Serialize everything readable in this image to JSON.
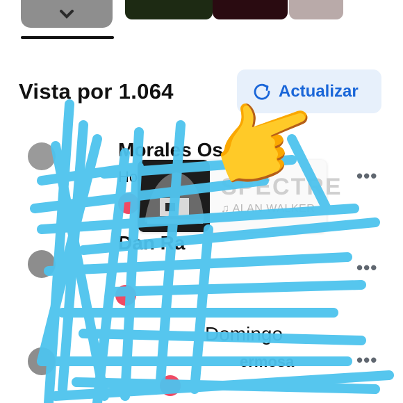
{
  "header": {
    "more_stories_icon": "chevron-down-icon",
    "story_colors": [
      "#1a2a12",
      "#2a0a10",
      "#b8a8a8"
    ]
  },
  "viewers": {
    "title": "Vista por 1.064",
    "refresh_label": "Actualizar",
    "refresh_icon": "refresh-icon",
    "accent_color": "#1a66d8"
  },
  "music_sticker": {
    "title": "SPECTRE",
    "artist": "ALAN WALKER",
    "note_icon": "music-note-icon"
  },
  "list": [
    {
      "name": "Morales Os",
      "subtitle": "Ho",
      "reaction": "heart"
    },
    {
      "name": "Dan Ra",
      "subtitle": "",
      "reaction": "heart"
    },
    {
      "name": "Domingo",
      "subtitle": "ermosa",
      "reaction": "heart"
    }
  ],
  "more_label": "•••",
  "overlay": {
    "emoji": "👉",
    "scribble_color": "#4ec3ee"
  }
}
